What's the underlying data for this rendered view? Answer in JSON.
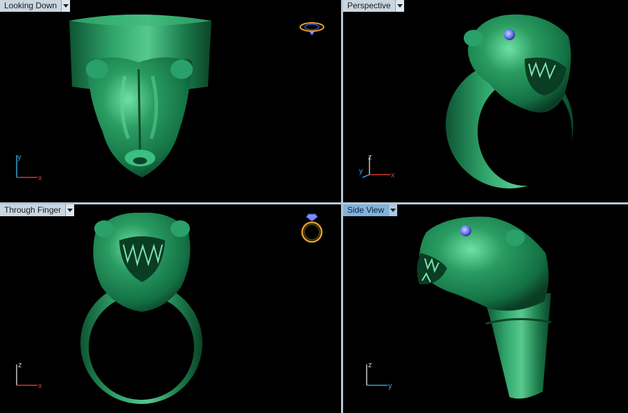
{
  "viewports": {
    "top_left": {
      "title": "Looking Down",
      "axes": [
        "y",
        "x"
      ]
    },
    "top_right": {
      "title": "Perspective",
      "axes": [
        "z",
        "y",
        "x"
      ]
    },
    "bottom_left": {
      "title": "Through Finger",
      "axes": [
        "z",
        "x"
      ]
    },
    "bottom_right": {
      "title": "Side View",
      "axes": [
        "z",
        "y"
      ]
    }
  },
  "colors": {
    "model": "#1f8a55",
    "model_highlight": "#5fd49a",
    "model_shadow": "#0b3f25",
    "gem": "#7f8cf5",
    "background": "#000000",
    "tab_active": "#7fb2dc",
    "axis_x": "#d23a2a",
    "axis_y": "#3aa0d2",
    "axis_z": "#c8c8c8"
  },
  "icons": {
    "ring_top_icon": "ring-top-view-icon",
    "ring_front_icon": "ring-front-view-icon"
  }
}
